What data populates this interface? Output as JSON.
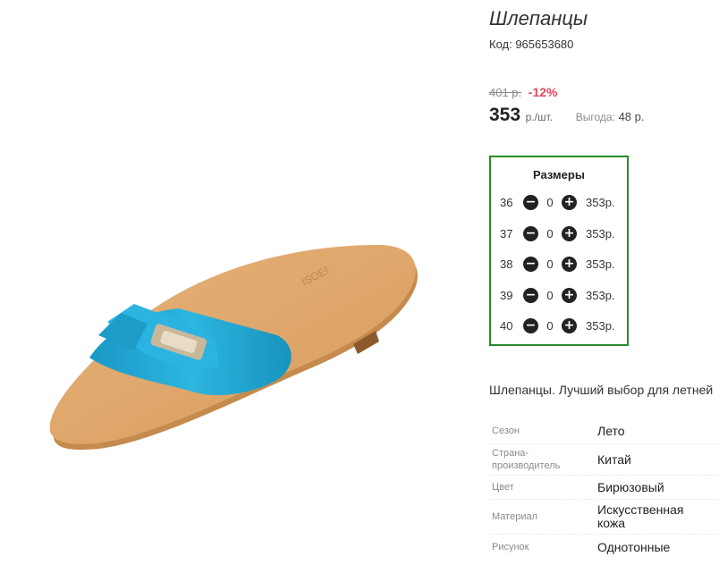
{
  "product": {
    "title": "Шлепанцы",
    "code": "Код: 965653680",
    "image_alt": "sandal"
  },
  "price": {
    "old": "401 р.",
    "discount": "-12%",
    "current": "353",
    "unit": "р./шт.",
    "benefit_label": "Выгода:",
    "benefit_value": "48 р."
  },
  "sizes": {
    "title": "Размеры",
    "minus_icon": "minus-circle-icon",
    "plus_icon": "plus-circle-icon",
    "items": [
      {
        "size": "36",
        "qty": "0",
        "price": "353р."
      },
      {
        "size": "37",
        "qty": "0",
        "price": "353р."
      },
      {
        "size": "38",
        "qty": "0",
        "price": "353р."
      },
      {
        "size": "39",
        "qty": "0",
        "price": "353р."
      },
      {
        "size": "40",
        "qty": "0",
        "price": "353р."
      }
    ]
  },
  "description": "Шлепанцы. Лучший выбор для летней",
  "attributes": [
    {
      "label": "Сезон",
      "value": "Лето"
    },
    {
      "label": "Страна-производитель",
      "value": "Китай"
    },
    {
      "label": "Цвет",
      "value": "Бирюзовый"
    },
    {
      "label": "Материал",
      "value": "Искусственная кожа"
    },
    {
      "label": "Рисунок",
      "value": "Однотонные"
    }
  ],
  "colors": {
    "discount": "#e0455c",
    "sizes_border": "#2a8a2a",
    "sandal_blue": "#1fa5d0",
    "sole": "#e0ac6e"
  }
}
